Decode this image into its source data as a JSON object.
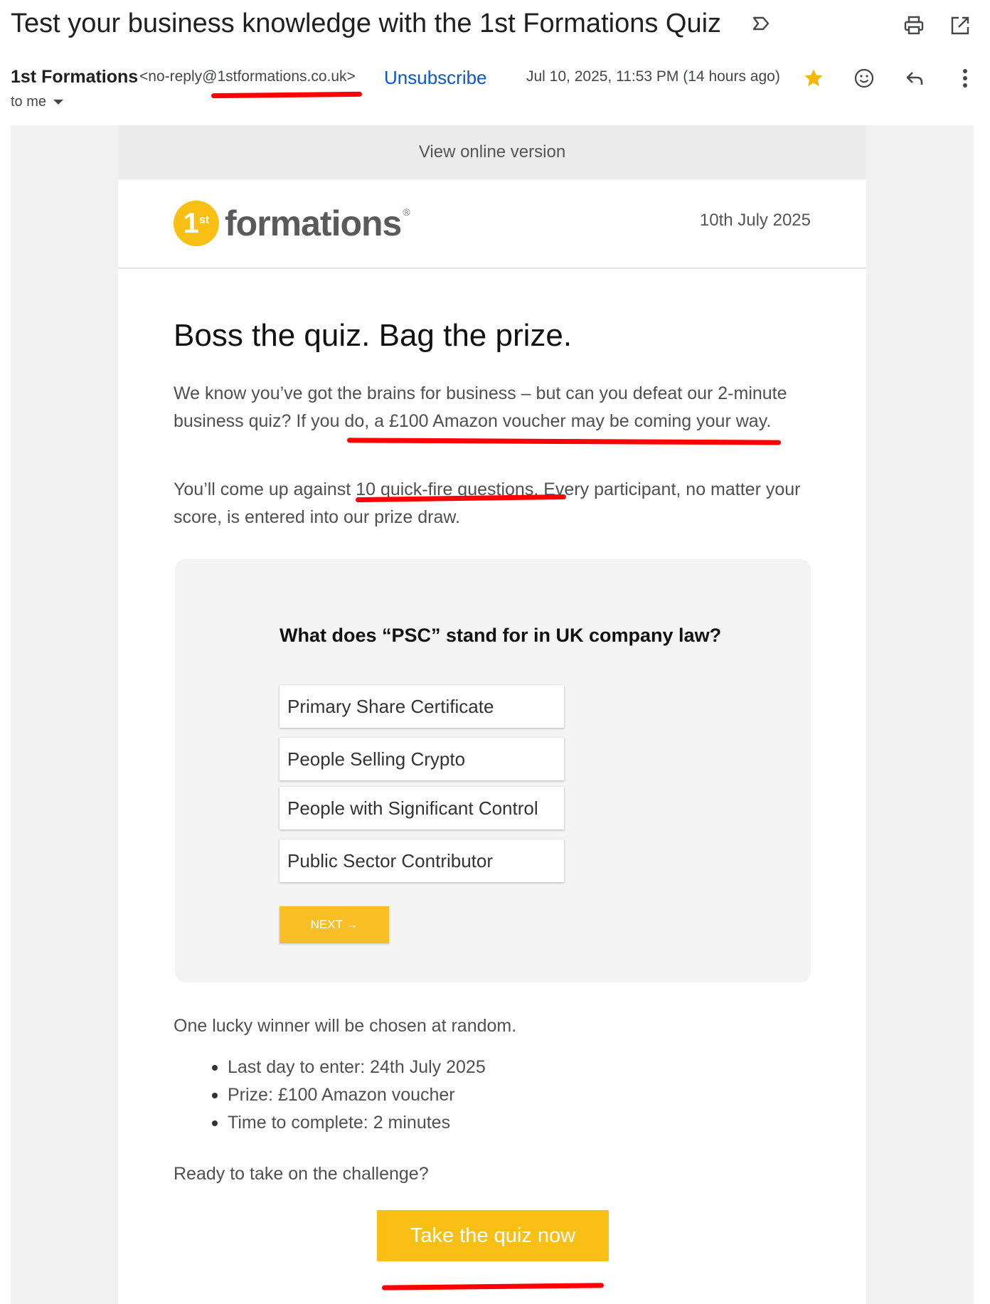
{
  "email": {
    "subject": "Test your business knowledge with the 1st Formations Quiz",
    "sender_name": "1st Formations",
    "sender_email": "<no-reply@1stformations.co.uk>",
    "unsubscribe": "Unsubscribe",
    "date": "Jul 10, 2025, 11:53 PM (14 hours ago)",
    "recipient": "to me",
    "starred": true
  },
  "icons": {
    "label": "label-important-icon",
    "print": "print-icon",
    "open_new_window": "open-in-new-window-icon",
    "star": "star-icon",
    "emoji": "emoji-reaction-icon",
    "reply": "reply-icon",
    "more": "more-vertical-icon"
  },
  "colors": {
    "accent_yellow": "#f9bf14",
    "link_blue": "#0b57d0",
    "annotation_red": "#ff0000"
  },
  "body": {
    "view_online": "View online version",
    "logo": {
      "number": "1",
      "superscript": "st",
      "word": "formations",
      "reg": "®"
    },
    "header_date": "10th July 2025",
    "headline": "Boss the quiz. Bag the prize.",
    "paragraph1": "We know you’ve got the brains for business – but can you defeat our 2-minute business quiz? If you do, a £100 Amazon voucher may be coming your way.",
    "paragraph2": "You’ll come up against 10 quick-fire questions. Every participant, no matter your score, is entered into our prize draw.",
    "quiz": {
      "question": "What does “PSC” stand for in UK company law?",
      "options": [
        "Primary Share Certificate",
        "People Selling Crypto",
        "People with Significant Control",
        "Public Sector Contributor"
      ],
      "next": "NEXT →"
    },
    "winner_text": "One lucky winner will be chosen at random.",
    "bullets": [
      "Last day to enter: 24th July 2025",
      "Prize: £100 Amazon voucher",
      "Time to complete: 2 minutes"
    ],
    "ready_text": "Ready to take on the challenge?",
    "cta": "Take the quiz now"
  }
}
